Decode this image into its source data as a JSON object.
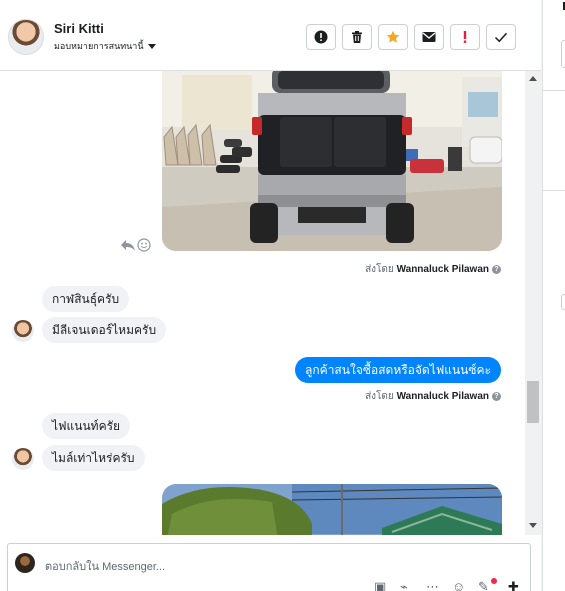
{
  "header": {
    "contact_name": "Siri Kitti",
    "assign_label": "มอบหมายการสนทนานี้",
    "actions": [
      {
        "icon": "exclamation-circle-icon",
        "color": "#1c1e21"
      },
      {
        "icon": "trash-icon",
        "color": "#1c1e21"
      },
      {
        "icon": "star-icon",
        "color": "#f5a623"
      },
      {
        "icon": "envelope-icon",
        "color": "#1c1e21"
      },
      {
        "icon": "exclamation-icon",
        "color": "#e41e3f"
      },
      {
        "icon": "check-icon",
        "color": "#1c1e21"
      }
    ]
  },
  "thread": {
    "sent_by_prefix": "ส่งโดย",
    "agent_name": "Wannaluck Pilawan",
    "messages": [
      {
        "text": "กาฬสินธุ์ครับ"
      },
      {
        "text": "มีลีเจนเดอร์ไหมครับ"
      },
      {
        "text": "ลูกค้าสนใจซื้อสดหรือจัดไฟแนนซ์คะ"
      },
      {
        "text": "ไฟแนนท์ครัย"
      },
      {
        "text": "ไมล์เท่าไหร่ครับ"
      }
    ]
  },
  "composer": {
    "placeholder": "ตอบกลับใน Messenger..."
  },
  "colors": {
    "accent": "#0084ff",
    "incoming_bubble": "#f0f2f5",
    "notification_dot": "#f02849"
  }
}
